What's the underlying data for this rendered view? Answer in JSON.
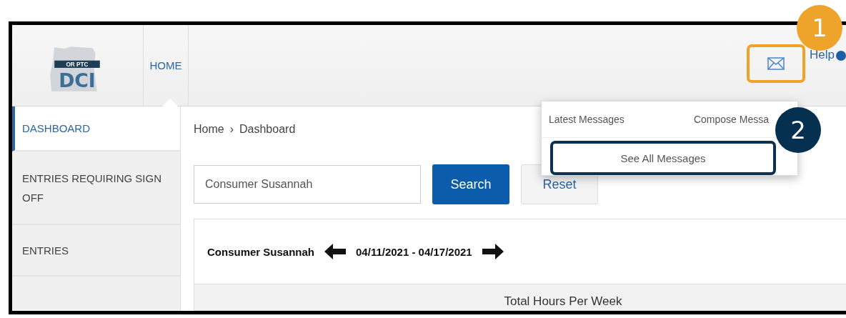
{
  "logo": {
    "banner": "OR PTC",
    "letters": "DCI"
  },
  "nav": {
    "tabs": [
      {
        "label": "HOME",
        "selected": true
      }
    ]
  },
  "header": {
    "help": "Help"
  },
  "sidebar": {
    "items": [
      {
        "label": "DASHBOARD",
        "selected": true
      },
      {
        "label": "ENTRIES REQUIRING SIGN OFF",
        "selected": false
      },
      {
        "label": "ENTRIES",
        "selected": false
      }
    ]
  },
  "breadcrumb": [
    "Home",
    "Dashboard"
  ],
  "breadcrumb_separator": "›",
  "search": {
    "value": "Consumer Susannah",
    "button": "Search",
    "reset": "Reset"
  },
  "week": {
    "consumer": "Consumer Susannah",
    "range": "04/11/2021 - 04/17/2021",
    "panel_title": "Total Hours Per Week"
  },
  "messages_menu": {
    "latest": "Latest Messages",
    "compose": "Compose Messa",
    "see_all": "See All Messages"
  },
  "callouts": [
    "1",
    "2"
  ]
}
